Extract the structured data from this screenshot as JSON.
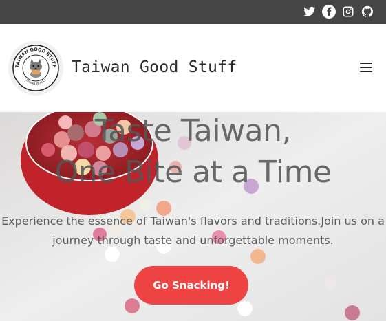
{
  "topbar": {
    "social_icons": [
      "twitter-icon",
      "facebook-icon",
      "instagram-icon",
      "github-icon"
    ]
  },
  "header": {
    "site_title": "Taiwan Good Stuff",
    "logo": {
      "ring_text_top": "TAIWAN GOOD STUFF",
      "ring_text_bottom": "TAIWAN SNACKS"
    },
    "menu_icon": "hamburger-icon"
  },
  "hero": {
    "title_line1": "Taste Taiwan,",
    "title_line2": "One Bite at a Time",
    "subtitle_line1": "Experience the essence of Taiwan's flavors and traditions.Join us on a",
    "subtitle_line2": "journey through taste and unforgettable moments.",
    "cta_label": "Go Snacking!"
  },
  "colors": {
    "topbar_bg": "#454545",
    "accent": "#ef4444",
    "hero_bg": "#e9e8e8"
  }
}
